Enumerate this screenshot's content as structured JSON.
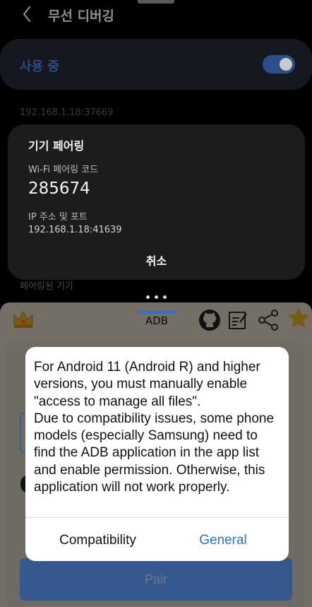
{
  "system": {
    "title": "무선 디버깅",
    "usage_label": "사용 중",
    "usage_enabled": true,
    "ip_port": "192.168.1.18:37669",
    "paired_devices_label": "페어링된 기기"
  },
  "pairing_dialog": {
    "title": "기기 페어링",
    "code_label": "Wi-Fi 페어링 코드",
    "code": "285674",
    "ip_label": "IP 주소 및 포트",
    "ip_value": "192.168.1.18:41639",
    "cancel_label": "취소"
  },
  "app": {
    "tab_label": "ADB",
    "pair_button_label": "Pair",
    "icons": [
      "crown-icon",
      "github-icon",
      "edit-note-icon",
      "share-icon",
      "star-icon"
    ],
    "accent_color": "#2e6fd6"
  },
  "notice_dialog": {
    "message": "For Android 11 (Android R) and higher versions, you must manually enable \"access to manage all files\".\nDue to compatibility issues, some phone models (especially Samsung) need to find the ADB application in the app list and enable permission. Otherwise, this application will not work properly.",
    "compat_button": "Compatibility",
    "general_button": "General",
    "general_color": "#2a73c9"
  }
}
